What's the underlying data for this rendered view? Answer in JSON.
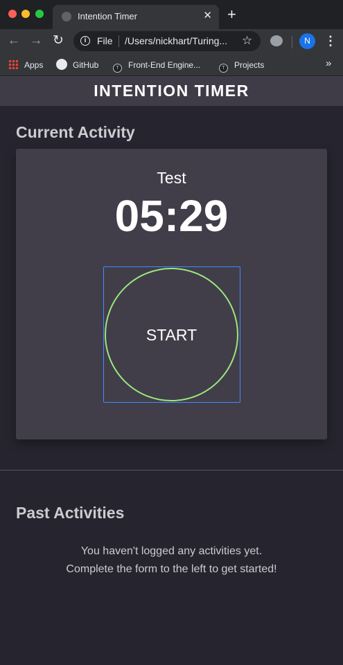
{
  "browser": {
    "tab_title": "Intention Timer",
    "tab_close": "✕",
    "new_tab": "+",
    "address_scheme": "File",
    "address_url": "/Users/nickhart/Turing...",
    "avatar_initial": "N",
    "bookmarks": [
      {
        "label": "Apps",
        "icon": "apps-grid-icon"
      },
      {
        "label": "GitHub",
        "icon": "github-icon"
      },
      {
        "label": "Front-End Engine...",
        "icon": "turing-icon"
      },
      {
        "label": "Projects",
        "icon": "turing-icon"
      }
    ],
    "bookmarks_overflow": "»"
  },
  "app": {
    "title": "INTENTION TIMER",
    "current_section_title": "Current Activity",
    "activity_name": "Test",
    "timer_value": "05:29",
    "start_label": "START",
    "past_section_title": "Past Activities",
    "empty_line_1": "You haven't logged any activities yet.",
    "empty_line_2": "Complete the form to the left to get started!"
  },
  "colors": {
    "background": "#26252f",
    "header": "#3f3c47",
    "card": "#413e4a",
    "start_ring": "#9be87c",
    "focus_outline": "#3f8cff"
  }
}
